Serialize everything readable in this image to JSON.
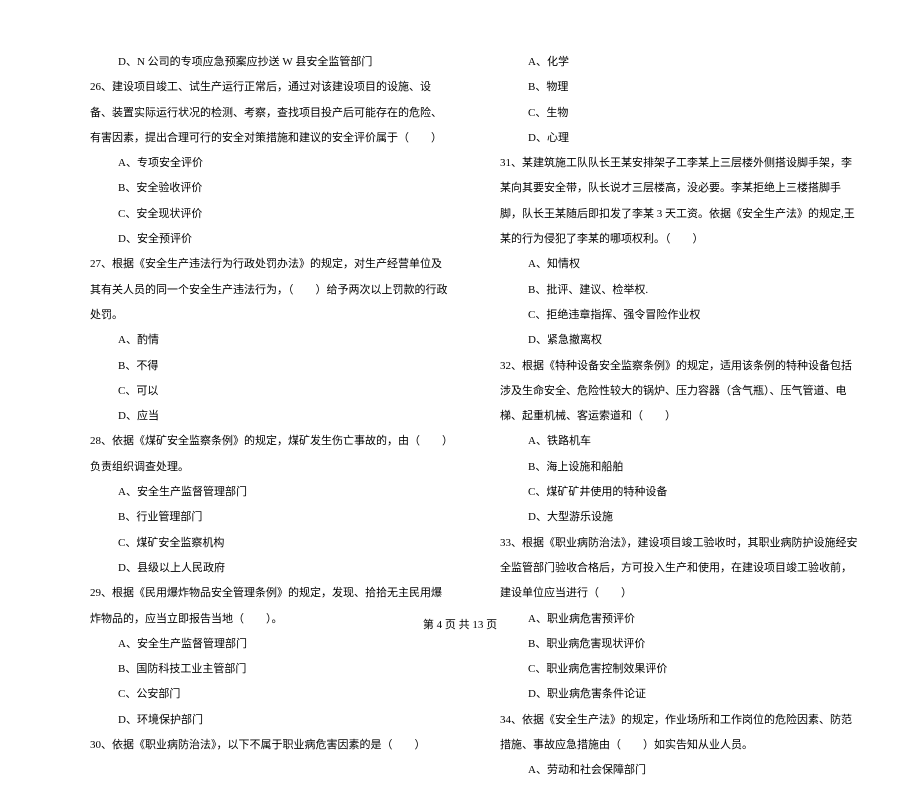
{
  "col1": {
    "q25_d": "D、N 公司的专项应急预案应抄送 W 县安全监管部门",
    "q26_text": "26、建设项目竣工、试生产运行正常后，通过对该建设项目的设施、设备、装置实际运行状况的检测、考察，查找项目投产后可能存在的危险、有害因素，提出合理可行的安全对策措施和建议的安全评价属于（　　）",
    "q26_a": "A、专项安全评价",
    "q26_b": "B、安全验收评价",
    "q26_c": "C、安全现状评价",
    "q26_d": "D、安全预评价",
    "q27_text": "27、根据《安全生产违法行为行政处罚办法》的规定，对生产经营单位及其有关人员的同一个安全生产违法行为，（　　）给予两次以上罚款的行政处罚。",
    "q27_a": "A、酌情",
    "q27_b": "B、不得",
    "q27_c": "C、可以",
    "q27_d": "D、应当",
    "q28_text": "28、依据《煤矿安全监察条例》的规定，煤矿发生伤亡事故的，由（　　）负责组织调查处理。",
    "q28_a": "A、安全生产监督管理部门",
    "q28_b": "B、行业管理部门",
    "q28_c": "C、煤矿安全监察机构",
    "q28_d": "D、县级以上人民政府",
    "q29_text": "29、根据《民用爆炸物品安全管理条例》的规定，发现、拾拾无主民用爆炸物品的，应当立即报告当地（　　）。",
    "q29_a": "A、安全生产监督管理部门",
    "q29_b": "B、国防科技工业主管部门",
    "q29_c": "C、公安部门",
    "q29_d": "D、环境保护部门",
    "q30_text": "30、依据《职业病防治法》，以下不属于职业病危害因素的是（　　）"
  },
  "col2": {
    "q30_a": "A、化学",
    "q30_b": "B、物理",
    "q30_c": "C、生物",
    "q30_d": "D、心理",
    "q31_text": "31、某建筑施工队队长王某安排架子工李某上三层楼外侧搭设脚手架，李某向其要安全带，队长说才三层楼高，没必要。李某拒绝上三楼搭脚手脚，队长王某随后即扣发了李某 3 天工资。依据《安全生产法》的规定,王某的行为侵犯了李某的哪项权利。（　　）",
    "q31_a": "A、知情权",
    "q31_b": "B、批评、建议、检举权.",
    "q31_c": "C、拒绝违章指挥、强令冒险作业权",
    "q31_d": "D、紧急撤离权",
    "q32_text": "32、根据《特种设备安全监察条例》的规定，适用该条例的特种设备包括涉及生命安全、危险性较大的锅炉、压力容器（含气瓶）、压气管道、电梯、起重机械、客运索道和（　　）",
    "q32_a": "A、铁路机车",
    "q32_b": "B、海上设施和船舶",
    "q32_c": "C、煤矿矿井使用的特种设备",
    "q32_d": "D、大型游乐设施",
    "q33_text": "33、根据《职业病防治法》，建设项目竣工验收时，其职业病防护设施经安全监管部门验收合格后，方可投入生产和使用，在建设项目竣工验收前，建设单位应当进行（　　）",
    "q33_a": "A、职业病危害预评价",
    "q33_b": "B、职业病危害现状评价",
    "q33_c": "C、职业病危害控制效果评价",
    "q33_d": "D、职业病危害条件论证",
    "q34_text": "34、依据《安全生产法》的规定，作业场所和工作岗位的危险因素、防范措施、事故应急措施由（　　）如实告知从业人员。",
    "q34_a": "A、劳动和社会保障部门"
  },
  "footer": "第 4 页 共 13 页"
}
